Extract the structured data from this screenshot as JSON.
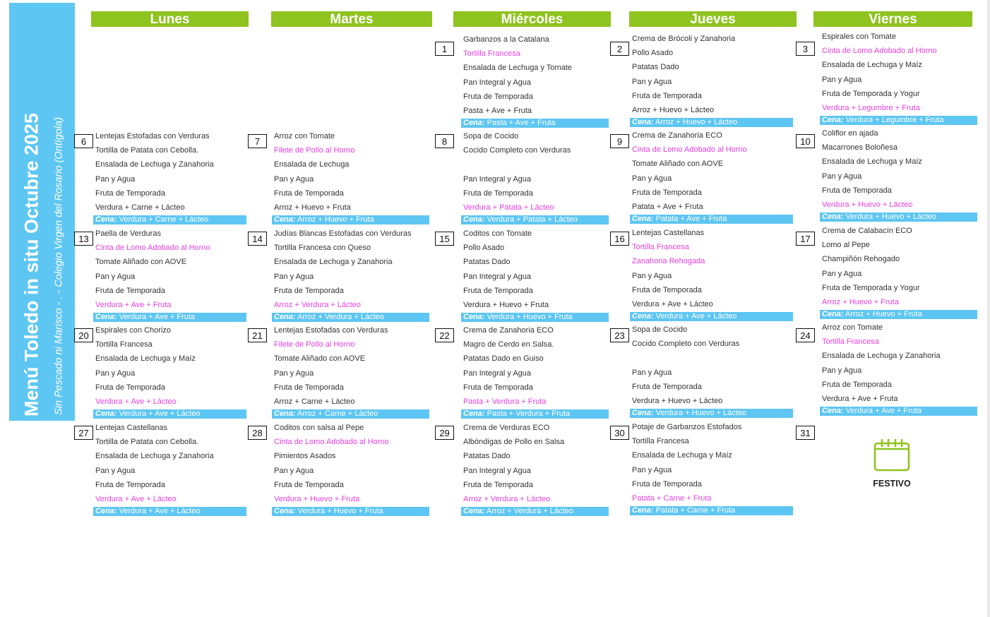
{
  "sidebar": {
    "title": "Menú Toledo in situ Octubre 2025",
    "subtitle": "Sin Pescado ni Marisco - . - Colegio Virgen del Rosario (Ontígola)"
  },
  "days": [
    "Lunes",
    "Martes",
    "Miércoles",
    "Jueves",
    "Viernes"
  ],
  "cena_label": "Cena:",
  "accent_colors": {
    "header_green": "#8fc31f",
    "sidebar_blue": "#5ec6f2",
    "pink": "#e53fe0"
  },
  "weeks": [
    [
      null,
      null,
      {
        "day": "1",
        "items": [
          [
            "Garbanzos a la Catalana",
            0
          ],
          [
            "Tortilla Francesa",
            1
          ],
          [
            "Ensalada de Lechuga y Tomate",
            0
          ],
          [
            "Pan Integral y Agua",
            0
          ],
          [
            "Fruta de Temporada",
            0
          ],
          [
            "Pasta + Ave + Fruta",
            0
          ]
        ],
        "cena": "Pasta + Ave + Fruta"
      },
      {
        "day": "2",
        "items": [
          [
            "Crema de Brócoli y Zanahoria",
            0
          ],
          [
            "Pollo Asado",
            0
          ],
          [
            "Patatas Dado",
            0
          ],
          [
            "Pan y Agua",
            0
          ],
          [
            "Fruta de Temporada",
            0
          ],
          [
            "Arroz + Huevo + Lácteo",
            0
          ]
        ],
        "cena": "Arroz + Huevo + Lácteo"
      },
      {
        "day": "3",
        "items": [
          [
            "Espirales con Tomate",
            0
          ],
          [
            "Cinta de Lomo Adobado al Horno",
            1
          ],
          [
            "Ensalada de Lechuga y Maíz",
            0
          ],
          [
            "Pan y Agua",
            0
          ],
          [
            "Fruta de Temporada y Yogur",
            0
          ],
          [
            "Verdura + Legumbre + Fruta",
            1
          ]
        ],
        "cena": "Verdura + Legumbre + Fruta"
      }
    ],
    [
      {
        "day": "6",
        "items": [
          [
            "Lentejas Estofadas con Verduras",
            0
          ],
          [
            "Tortilla de Patata con Cebolla.",
            0
          ],
          [
            "Ensalada de Lechuga y Zanahoria",
            0
          ],
          [
            "Pan y Agua",
            0
          ],
          [
            "Fruta de Temporada",
            0
          ],
          [
            "Verdura + Carne + Lácteo",
            0
          ]
        ],
        "cena": "Verdura + Carne + Lácteo"
      },
      {
        "day": "7",
        "items": [
          [
            "Arroz con Tomate",
            0
          ],
          [
            "Filete de Pollo al Horno",
            1
          ],
          [
            "Ensalada de Lechuga",
            0
          ],
          [
            "Pan y Agua",
            0
          ],
          [
            "Fruta de Temporada",
            0
          ],
          [
            "Arroz + Huevo + Fruta",
            0
          ]
        ],
        "cena": "Arroz + Huevo + Fruta"
      },
      {
        "day": "8",
        "items": [
          [
            "Sopa de Cocido",
            0
          ],
          [
            "Cocido Completo con Verduras",
            0
          ],
          [
            "",
            0
          ],
          [
            "Pan Integral y Agua",
            0
          ],
          [
            "Fruta de Temporada",
            0
          ],
          [
            "Verdura + Patata + Lácteo",
            1
          ]
        ],
        "cena": "Verdura + Patata + Lácteo"
      },
      {
        "day": "9",
        "items": [
          [
            "Crema de Zanahoria ECO",
            0
          ],
          [
            "Cinta de Lomo Adobado al Horno",
            1
          ],
          [
            "Tomate Aliñado con AOVE",
            0
          ],
          [
            "Pan y Agua",
            0
          ],
          [
            "Fruta de Temporada",
            0
          ],
          [
            "Patata + Ave + Fruta",
            0
          ]
        ],
        "cena": "Patata + Ave + Fruta"
      },
      {
        "day": "10",
        "items": [
          [
            "Coliflor en ajada",
            0
          ],
          [
            "Macarrones Boloñesa",
            0
          ],
          [
            "Ensalada de Lechuga y Maíz",
            0
          ],
          [
            "Pan y Agua",
            0
          ],
          [
            "Fruta de Temporada",
            0
          ],
          [
            "Verdura + Huevo + Lácteo",
            1
          ]
        ],
        "cena": "Verdura + Huevo + Lácteo"
      }
    ],
    [
      {
        "day": "13",
        "items": [
          [
            "Paella de Verduras",
            0
          ],
          [
            "Cinta de Lomo Adobado al Horno",
            1
          ],
          [
            "Tomate Aliñado con AOVE",
            0
          ],
          [
            "Pan y Agua",
            0
          ],
          [
            "Fruta de Temporada",
            0
          ],
          [
            "Verdura + Ave + Fruta",
            1
          ]
        ],
        "cena": "Verdura + Ave + Fruta"
      },
      {
        "day": "14",
        "items": [
          [
            "Judías Blancas Estofadas con Verduras",
            0
          ],
          [
            "Tortilla Francesa con Queso",
            0
          ],
          [
            "Ensalada de Lechuga y Zanahoria",
            0
          ],
          [
            "Pan y Agua",
            0
          ],
          [
            "Fruta de Temporada",
            0
          ],
          [
            "Arroz + Verdura + Lácteo",
            1
          ]
        ],
        "cena": "Arroz + Verdura + Lácteo"
      },
      {
        "day": "15",
        "items": [
          [
            "Coditos con Tomate",
            0
          ],
          [
            "Pollo Asado",
            0
          ],
          [
            "Patatas Dado",
            0
          ],
          [
            "Pan Integral y Agua",
            0
          ],
          [
            "Fruta de Temporada",
            0
          ],
          [
            "Verdura + Huevo + Fruta",
            0
          ]
        ],
        "cena": "Verdura + Huevo + Fruta"
      },
      {
        "day": "16",
        "items": [
          [
            "Lentejas Castellanas",
            0
          ],
          [
            "Tortilla Francesa",
            1
          ],
          [
            "Zanahoria Rehogada",
            1
          ],
          [
            "Pan y Agua",
            0
          ],
          [
            "Fruta de Temporada",
            0
          ],
          [
            "Verdura + Ave + Lácteo",
            0
          ]
        ],
        "cena": "Verdura + Ave + Lácteo"
      },
      {
        "day": "17",
        "items": [
          [
            "Crema de Calabacín ECO",
            0
          ],
          [
            "Lomo al Pepe",
            0
          ],
          [
            "Champiñón Rehogado",
            0
          ],
          [
            "Pan y Agua",
            0
          ],
          [
            "Fruta de Temporada y Yogur",
            0
          ],
          [
            "Arroz + Huevo + Fruta",
            1
          ]
        ],
        "cena": "Arroz + Huevo + Fruta"
      }
    ],
    [
      {
        "day": "20",
        "items": [
          [
            "Espirales con Chorizo",
            0
          ],
          [
            "Tortilla Francesa",
            0
          ],
          [
            "Ensalada de Lechuga y Maíz",
            0
          ],
          [
            "Pan y Agua",
            0
          ],
          [
            "Fruta de Temporada",
            0
          ],
          [
            "Verdura + Ave + Lácteo",
            1
          ]
        ],
        "cena": "Verdura + Ave + Lácteo"
      },
      {
        "day": "21",
        "items": [
          [
            "Lentejas Estofadas con Verduras",
            0
          ],
          [
            "Filete de Pollo al Horno",
            1
          ],
          [
            "Tomate Aliñado con AOVE",
            0
          ],
          [
            "Pan y Agua",
            0
          ],
          [
            "Fruta de Temporada",
            0
          ],
          [
            "Arroz + Carne + Lácteo",
            0
          ]
        ],
        "cena": "Arroz + Carne + Lácteo"
      },
      {
        "day": "22",
        "items": [
          [
            "Crema de Zanahoria ECO",
            0
          ],
          [
            "Magro de Cerdo en Salsa.",
            0
          ],
          [
            "Patatas Dado en Guiso",
            0
          ],
          [
            "Pan Integral y Agua",
            0
          ],
          [
            "Fruta de Temporada",
            0
          ],
          [
            "Pasta + Verdura + Fruta",
            1
          ]
        ],
        "cena": "Pasta + Verdura + Fruta"
      },
      {
        "day": "23",
        "items": [
          [
            "Sopa de Cocido",
            0
          ],
          [
            "Cocido Completo con Verduras",
            0
          ],
          [
            "",
            0
          ],
          [
            "Pan y Agua",
            0
          ],
          [
            "Fruta de Temporada",
            0
          ],
          [
            "Verdura + Huevo + Lácteo",
            0
          ]
        ],
        "cena": "Verdura + Huevo + Lácteo"
      },
      {
        "day": "24",
        "items": [
          [
            "Arroz con Tomate",
            0
          ],
          [
            "Tortilla Francesa",
            1
          ],
          [
            "Ensalada de Lechuga y Zanahoria",
            0
          ],
          [
            "Pan y Agua",
            0
          ],
          [
            "Fruta de Temporada",
            0
          ],
          [
            "Verdura + Ave + Fruta",
            0
          ]
        ],
        "cena": "Verdura + Ave + Fruta"
      }
    ],
    [
      {
        "day": "27",
        "items": [
          [
            "Lentejas Castellanas",
            0
          ],
          [
            "Tortilla de Patata con Cebolla.",
            0
          ],
          [
            "Ensalada de Lechuga y Zanahoria",
            0
          ],
          [
            "Pan y Agua",
            0
          ],
          [
            "Fruta de Temporada",
            0
          ],
          [
            "Verdura + Ave + Lácteo",
            1
          ]
        ],
        "cena": "Verdura + Ave + Lácteo"
      },
      {
        "day": "28",
        "items": [
          [
            "Coditos con salsa al Pepe",
            0
          ],
          [
            "Cinta de Lomo Adobado al Horno",
            1
          ],
          [
            "Pimientos Asados",
            0
          ],
          [
            "Pan y Agua",
            0
          ],
          [
            "Fruta de Temporada",
            0
          ],
          [
            "Verdura + Huevo + Fruta",
            1
          ]
        ],
        "cena": "Verdura + Huevo + Fruta"
      },
      {
        "day": "29",
        "items": [
          [
            "Crema de Verduras ECO",
            0
          ],
          [
            "Albóndigas de Pollo en Salsa",
            0
          ],
          [
            "Patatas Dado",
            0
          ],
          [
            "Pan Integral y Agua",
            0
          ],
          [
            "Fruta de Temporada",
            0
          ],
          [
            "Arroz + Verdura + Lácteo",
            1
          ]
        ],
        "cena": "Arroz + Verdura + Lácteo"
      },
      {
        "day": "30",
        "items": [
          [
            "Potaje de Garbanzos Estofados",
            0
          ],
          [
            "Tortilla Francesa",
            0
          ],
          [
            "Ensalada de Lechuga y Maíz",
            0
          ],
          [
            "Pan y Agua",
            0
          ],
          [
            "Fruta de Temporada",
            0
          ],
          [
            "Patata + Carne + Fruta",
            1
          ]
        ],
        "cena": "Patata + Carne + Fruta"
      },
      {
        "day": "31",
        "festivo": "FESTIVO"
      }
    ]
  ]
}
